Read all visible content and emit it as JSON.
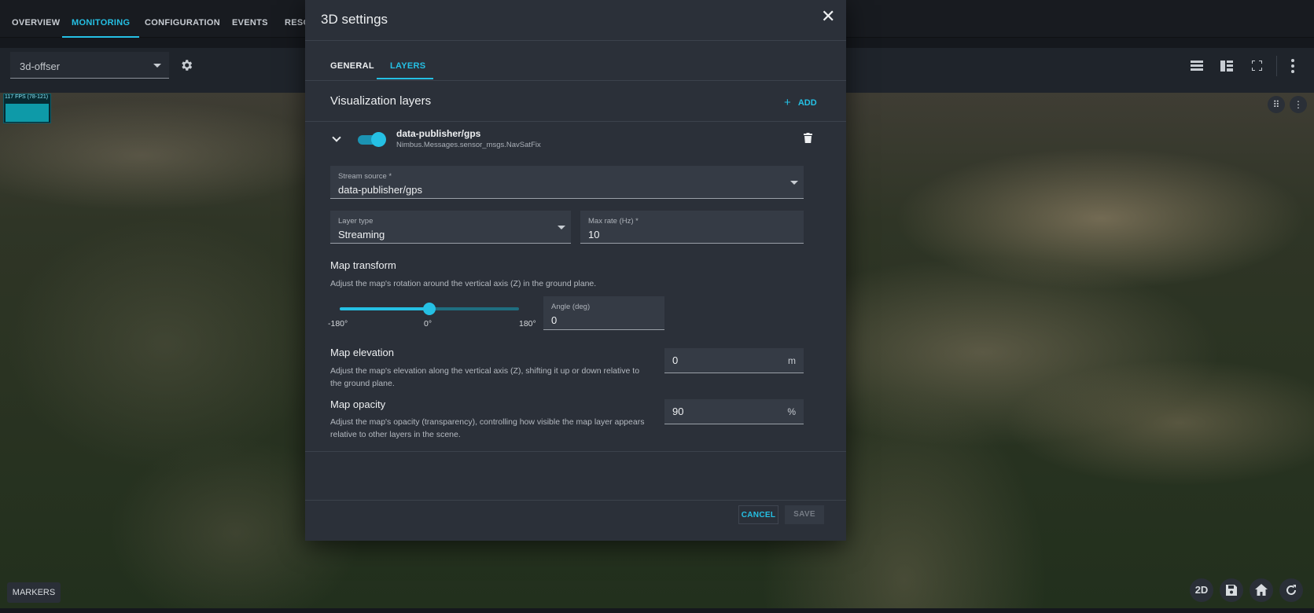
{
  "nav": {
    "tabs": [
      "OVERVIEW",
      "MONITORING",
      "CONFIGURATION",
      "EVENTS",
      "RESO"
    ],
    "active_index": 1
  },
  "toolbar": {
    "dashboard_select_value": "3d-offser",
    "icons": [
      "list-view-icon",
      "split-view-icon",
      "fullscreen-icon",
      "more-vert-icon"
    ]
  },
  "map": {
    "fps_text": "117 FPS (78-121)",
    "markers_label": "MARKERS",
    "view_mode_label": "2D",
    "icons": [
      "drag-handle-icon",
      "more-vert-icon",
      "save-icon",
      "home-icon",
      "refresh-icon"
    ]
  },
  "dialog": {
    "title": "3D settings",
    "tabs": [
      "GENERAL",
      "LAYERS"
    ],
    "active_tab_index": 1,
    "section_title": "Visualization layers",
    "add_label": "ADD",
    "layer": {
      "name": "data-publisher/gps",
      "type": "Nimbus.Messages.sensor_msgs.NavSatFix",
      "enabled": true,
      "stream_source_label": "Stream source *",
      "stream_source_value": "data-publisher/gps",
      "layer_type_label": "Layer type",
      "layer_type_value": "Streaming",
      "max_rate_label": "Max rate (Hz) *",
      "max_rate_value": "10"
    },
    "map_transform": {
      "title": "Map transform",
      "description": "Adjust the map's rotation around the vertical axis (Z) in the ground plane.",
      "slider_min_label": "-180°",
      "slider_mid_label": "0°",
      "slider_max_label": "180°",
      "slider_value": 0,
      "angle_label": "Angle (deg)",
      "angle_value": "0"
    },
    "map_elevation": {
      "title": "Map elevation",
      "description_line1": "Adjust the map's elevation along the vertical axis (Z), shifting it up or down relative to",
      "description_line2": "the ground plane.",
      "value": "0",
      "unit": "m"
    },
    "map_opacity": {
      "title": "Map opacity",
      "description_line1": "Adjust the map's opacity (transparency), controlling how visible the map layer appears",
      "description_line2": "relative to other layers in the scene.",
      "value": "90",
      "unit": "%"
    },
    "cancel_label": "CANCEL",
    "save_label": "SAVE",
    "colors": {
      "accent": "#25c0e4",
      "surface": "#2b3039",
      "field": "#353b45"
    }
  }
}
